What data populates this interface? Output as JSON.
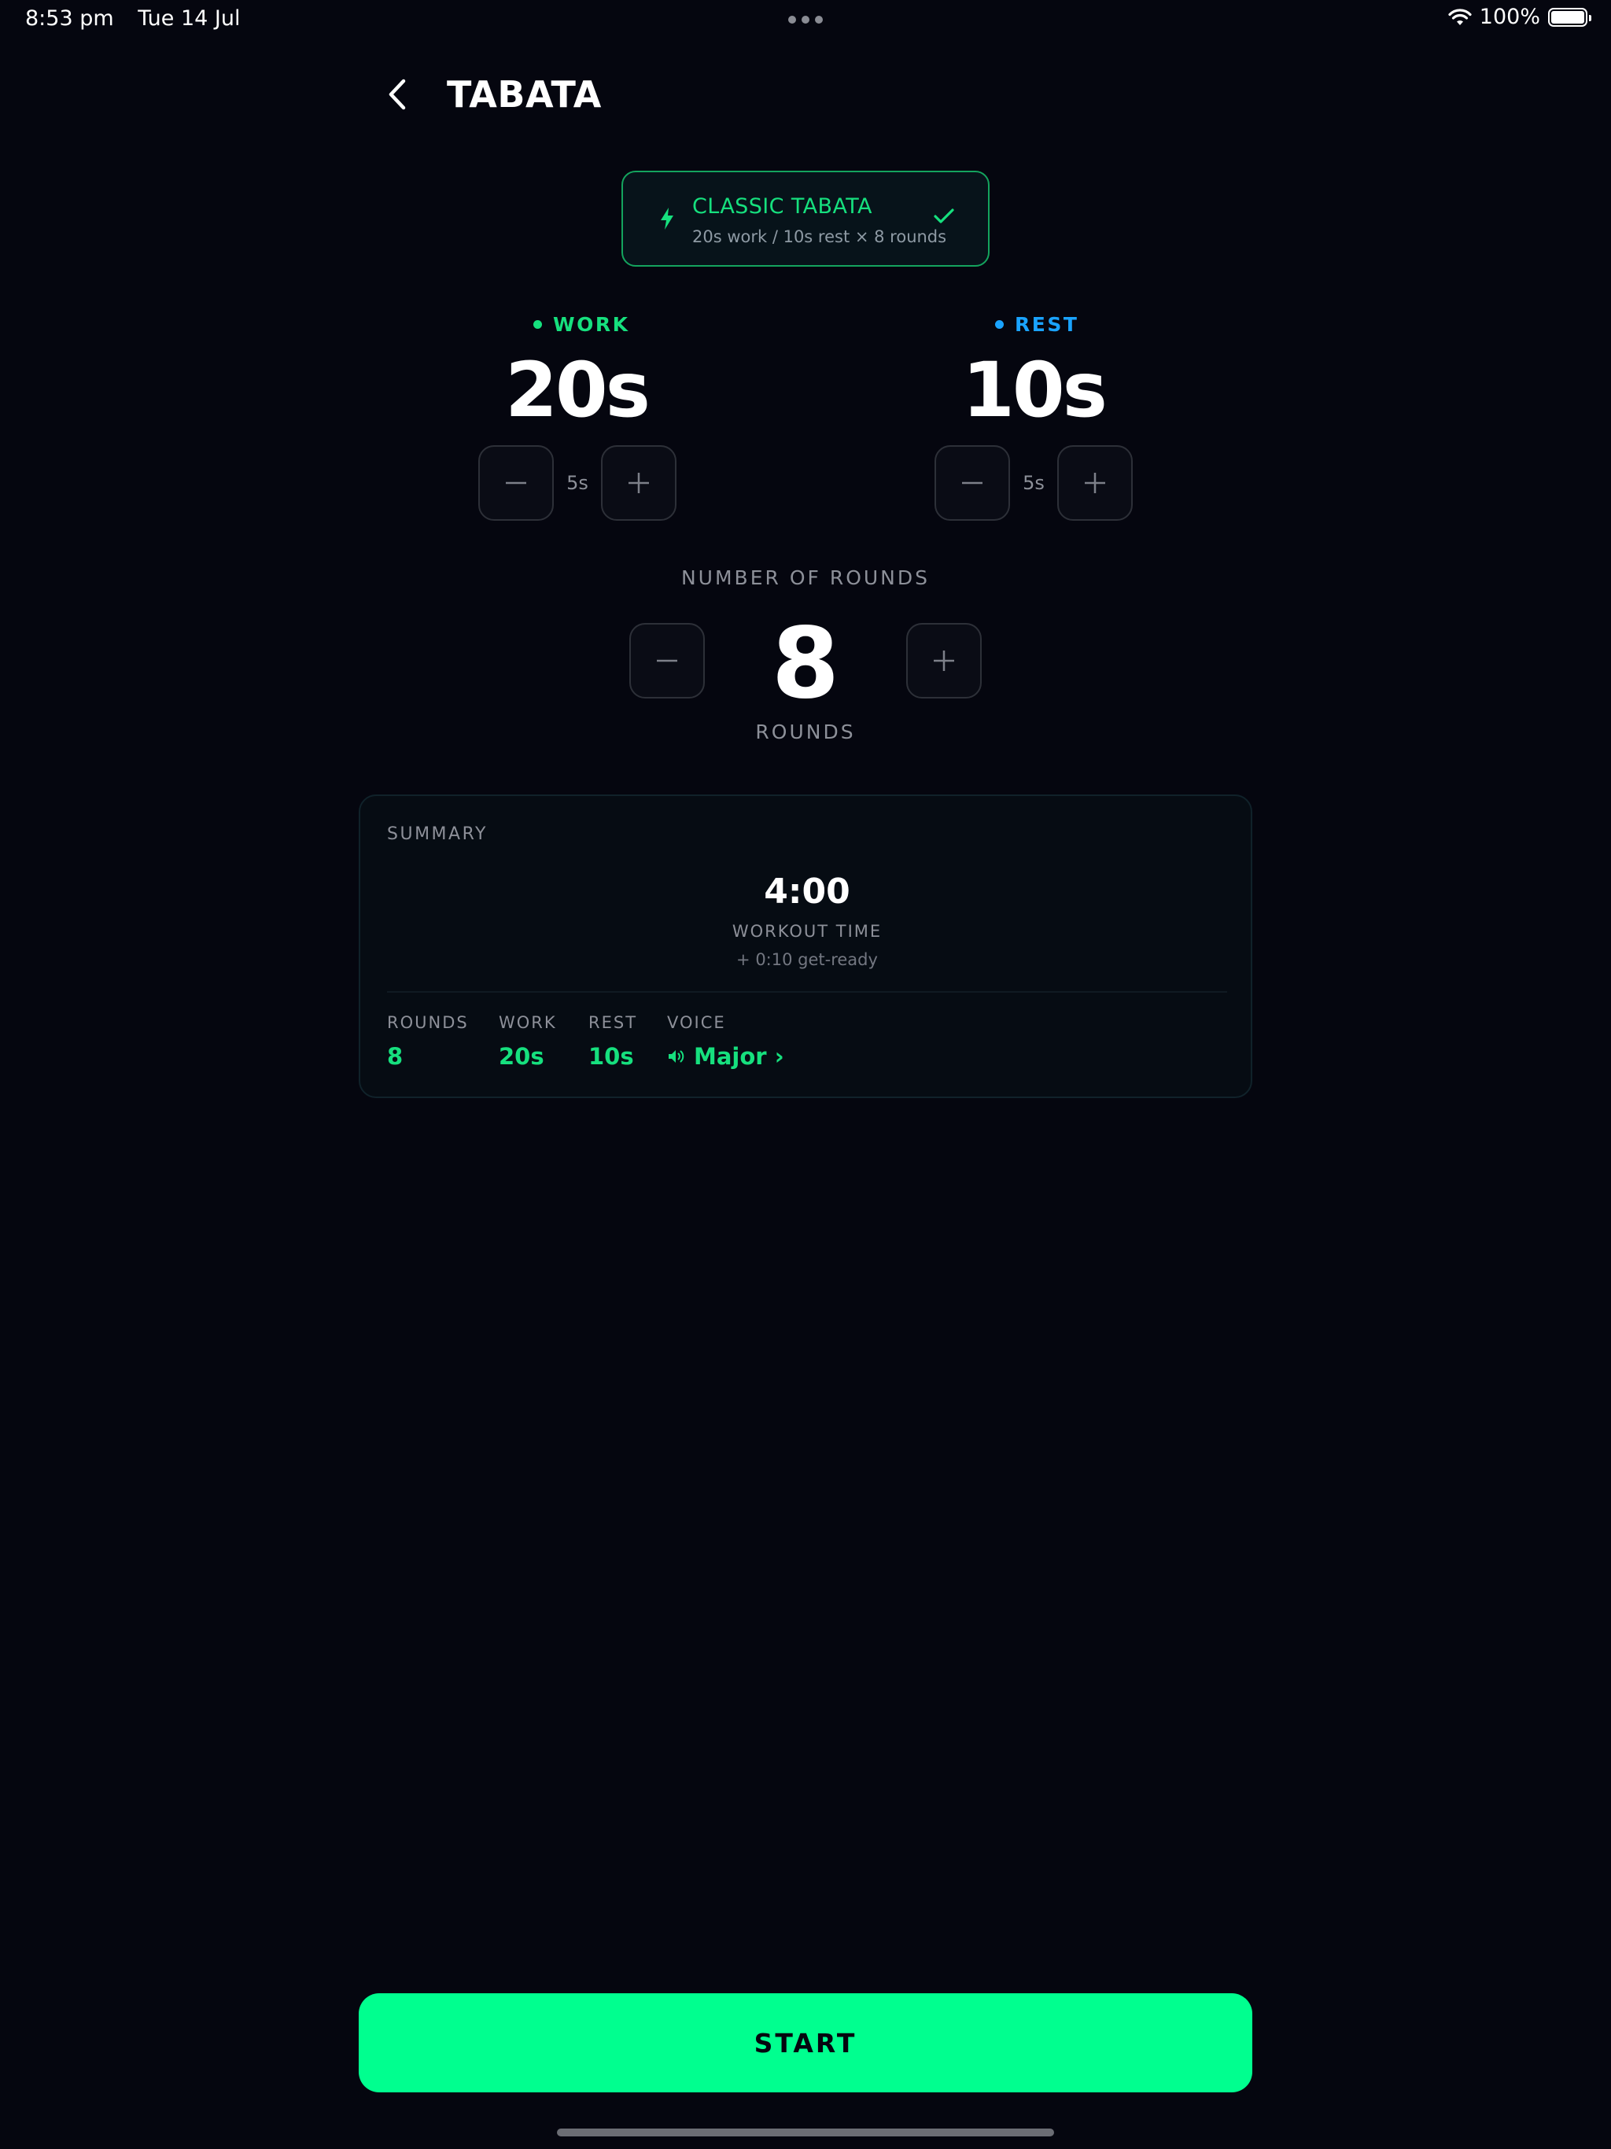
{
  "status_bar": {
    "time": "8:53 pm",
    "date": "Tue 14 Jul",
    "battery": "100%"
  },
  "header": {
    "title": "TABATA",
    "back_icon": "chevron-left-icon"
  },
  "preset": {
    "title": "CLASSIC TABATA",
    "subtitle": "20s work / 10s rest × 8 rounds",
    "icon": "bolt-icon",
    "selected_icon": "checkmark-icon"
  },
  "work": {
    "label": "WORK",
    "value": "20s",
    "step": "5s",
    "color": "#16e07e"
  },
  "rest": {
    "label": "REST",
    "value": "10s",
    "step": "5s",
    "color": "#1aa3ff"
  },
  "rounds": {
    "heading": "NUMBER OF ROUNDS",
    "value": "8",
    "unit": "ROUNDS"
  },
  "summary": {
    "title": "SUMMARY",
    "workout_time": "4:00",
    "workout_time_label": "WORKOUT TIME",
    "get_ready": "+ 0:10 get-ready",
    "stats": {
      "rounds_label": "ROUNDS",
      "rounds_value": "8",
      "work_label": "WORK",
      "work_value": "20s",
      "rest_label": "REST",
      "rest_value": "10s",
      "voice_label": "VOICE",
      "voice_value": "Major ›",
      "voice_icon": "speaker-icon"
    }
  },
  "start_button": {
    "label": "START"
  },
  "colors": {
    "background": "#05060f",
    "accent": "#00ff8f",
    "accent_text": "#16e07e",
    "rest_accent": "#1aa3ff"
  }
}
